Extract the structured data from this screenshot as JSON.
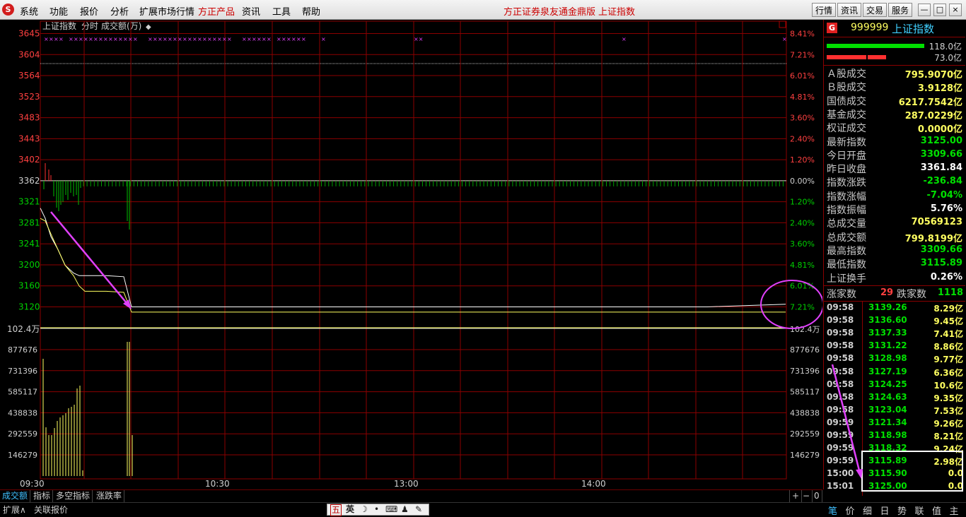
{
  "menu": {
    "items": [
      "系统",
      "功能",
      "报价",
      "分析",
      "扩展市场行情",
      "方正产品",
      "资讯",
      "工具",
      "帮助"
    ],
    "highlight_index": 5,
    "center_text": "方正证券泉友通金鼎版",
    "center_index": "上证指数",
    "right_buttons": [
      "行情",
      "资讯",
      "交易",
      "服务"
    ],
    "window_buttons": [
      "—",
      "□",
      "×"
    ]
  },
  "chart": {
    "title": "上证指数",
    "mode": "分时",
    "volume_label": "成交额(万)",
    "left_price_ticks": [
      "3645",
      "3604",
      "3564",
      "3523",
      "3483",
      "3443",
      "3402",
      "3362",
      "3321",
      "3281",
      "3241",
      "3200",
      "3160",
      "3120"
    ],
    "right_pct_ticks": [
      "8.41%",
      "7.21%",
      "6.01%",
      "4.81%",
      "3.60%",
      "2.40%",
      "1.20%",
      "0.00%",
      "1.20%",
      "2.40%",
      "3.60%",
      "4.81%",
      "6.01%",
      "7.21%"
    ],
    "vol_axis_label": "102.4万",
    "vol_ticks": [
      "877676",
      "731396",
      "585117",
      "438838",
      "292559",
      "146279"
    ],
    "time_ticks": [
      "09:30",
      "10:30",
      "13:00",
      "14:00"
    ],
    "colors": {
      "up": "#ff3030",
      "down": "#00c000",
      "grid": "#8b0000",
      "price": "#ffffff",
      "avg": "#ffff60",
      "annotation": "#e040fb"
    }
  },
  "chart_data": {
    "type": "line",
    "series": [
      {
        "name": "price",
        "values": [
          3309.66,
          3290,
          3255,
          3230,
          3200,
          3185,
          3180,
          3180,
          3180,
          3178,
          3120,
          3120,
          3120,
          3120,
          3125
        ]
      },
      {
        "name": "avg",
        "values": [
          3290,
          3285,
          3260,
          3230,
          3200,
          3180,
          3160,
          3150,
          3150,
          3148,
          3110,
          3110,
          3110,
          3110,
          3110
        ]
      }
    ]
  },
  "bottom_tabs": [
    "成交额",
    "指标",
    "多空指标",
    "涨跌率"
  ],
  "bottom_right": [
    "+",
    "−",
    "0"
  ],
  "status": {
    "left": [
      "扩展∧",
      "关联报价"
    ],
    "ime": [
      "五",
      "英"
    ]
  },
  "right_panel": {
    "code": "999999",
    "name": "上证指数",
    "bar_top_value": "118.0亿",
    "bar_bottom_value": "73.0亿",
    "stats": [
      {
        "label": "Ａ股成交",
        "value": "795.9070亿",
        "color": "#ffff60"
      },
      {
        "label": "Ｂ股成交",
        "value": "3.9128亿",
        "color": "#ffff60"
      },
      {
        "label": "国债成交",
        "value": "6217.7542亿",
        "color": "#ffff60"
      },
      {
        "label": "基金成交",
        "value": "287.0229亿",
        "color": "#ffff60"
      },
      {
        "label": "权证成交",
        "value": "0.0000亿",
        "color": "#ffff60"
      },
      {
        "label": "最新指数",
        "value": "3125.00",
        "color": "#00e000"
      },
      {
        "label": "今日开盘",
        "value": "3309.66",
        "color": "#00e000"
      },
      {
        "label": "昨日收盘",
        "value": "3361.84",
        "color": "#ffffff"
      },
      {
        "label": "指数涨跌",
        "value": "-236.84",
        "color": "#00e000"
      },
      {
        "label": "指数涨幅",
        "value": "-7.04%",
        "color": "#00e000"
      },
      {
        "label": "指数振幅",
        "value": "5.76%",
        "color": "#ffffff"
      },
      {
        "label": "总成交量",
        "value": "70569123",
        "color": "#ffff60"
      },
      {
        "label": "总成交额",
        "value": "799.8199亿",
        "color": "#ffff60"
      },
      {
        "label": "最高指数",
        "value": "3309.66",
        "color": "#00e000"
      },
      {
        "label": "最低指数",
        "value": "3115.89",
        "color": "#00e000"
      },
      {
        "label": "上证换手",
        "value": "0.26%",
        "color": "#ffffff"
      }
    ],
    "advance_label": "涨家数",
    "advance_value": "29",
    "decline_label": "跌家数",
    "decline_value": "1118",
    "ticks": [
      {
        "time": "09:58",
        "price": "3139.26",
        "amount": "8.29亿"
      },
      {
        "time": "09:58",
        "price": "3136.60",
        "amount": "9.45亿"
      },
      {
        "time": "09:58",
        "price": "3137.33",
        "amount": "7.41亿"
      },
      {
        "time": "09:58",
        "price": "3131.22",
        "amount": "8.86亿"
      },
      {
        "time": "09:58",
        "price": "3128.98",
        "amount": "9.77亿"
      },
      {
        "time": "09:58",
        "price": "3127.19",
        "amount": "6.36亿"
      },
      {
        "time": "09:58",
        "price": "3124.25",
        "amount": "10.6亿"
      },
      {
        "time": "09:58",
        "price": "3124.63",
        "amount": "9.35亿"
      },
      {
        "time": "09:58",
        "price": "3123.04",
        "amount": "7.53亿"
      },
      {
        "time": "09:59",
        "price": "3121.34",
        "amount": "9.26亿"
      },
      {
        "time": "09:59",
        "price": "3118.98",
        "amount": "8.21亿"
      },
      {
        "time": "09:59",
        "price": "3118.32",
        "amount": "9.24亿"
      },
      {
        "time": "09:59",
        "price": "3115.89",
        "amount": "2.98亿"
      },
      {
        "time": "15:00",
        "price": "3115.90",
        "amount": "0.0"
      },
      {
        "time": "15:01",
        "price": "3125.00",
        "amount": "0.0"
      }
    ],
    "bottom_tabs": [
      "笔",
      "价",
      "细",
      "日",
      "势",
      "联",
      "值",
      "主"
    ]
  }
}
